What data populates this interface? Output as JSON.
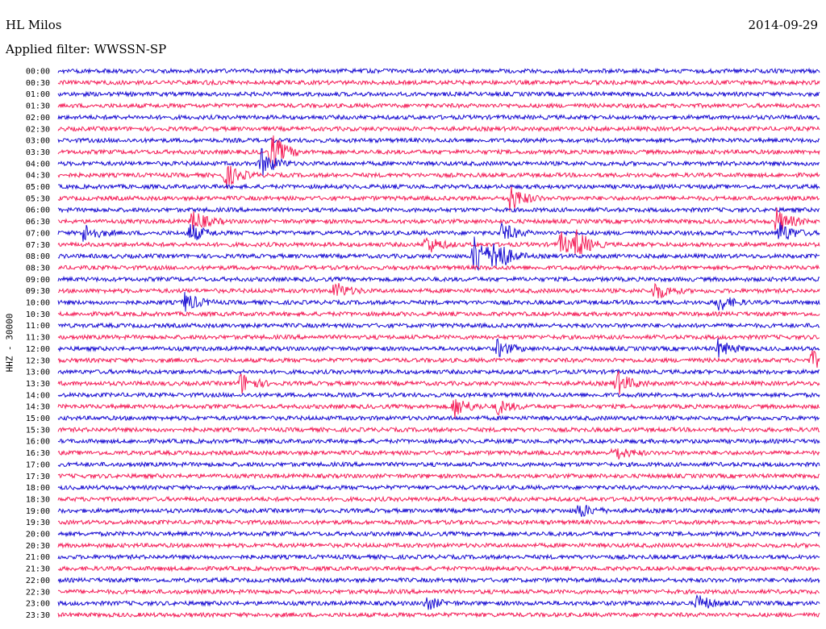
{
  "header": {
    "station": "HL Milos",
    "filter_label": "Applied filter: WWSSN-SP",
    "date": "2014-09-29"
  },
  "colors": {
    "blue": "#1a0ed2",
    "red": "#f4205a",
    "background": "#ffffff"
  },
  "chart_data": {
    "type": "line",
    "title": "HL Milos",
    "subtitle": "Applied filter: WWSSN-SP",
    "date": "2014-09-29",
    "ylabel": "HHZ - 30000",
    "xlabel": "",
    "grid": false,
    "legend": "none",
    "trace_colors_alternate": [
      "blue",
      "red"
    ],
    "row_labels": [
      "00:00",
      "00:30",
      "01:00",
      "01:30",
      "02:00",
      "02:30",
      "03:00",
      "03:30",
      "04:00",
      "04:30",
      "05:00",
      "05:30",
      "06:00",
      "06:30",
      "07:00",
      "07:30",
      "08:00",
      "08:30",
      "09:00",
      "09:30",
      "10:00",
      "10:30",
      "11:00",
      "11:30",
      "12:00",
      "12:30",
      "13:00",
      "13:30",
      "14:00",
      "14:30",
      "15:00",
      "15:30",
      "16:00",
      "16:30",
      "17:00",
      "17:30",
      "18:00",
      "18:30",
      "19:00",
      "19:30",
      "20:00",
      "20:30",
      "21:00",
      "21:30",
      "22:00",
      "22:30",
      "23:00",
      "23:30"
    ],
    "minutes_per_row": 30,
    "events": [
      {
        "row": "03:30",
        "minute": 8.4,
        "amplitude": 2.0
      },
      {
        "row": "04:00",
        "minute": 8.0,
        "amplitude": 1.5
      },
      {
        "row": "04:30",
        "minute": 6.6,
        "amplitude": 1.3
      },
      {
        "row": "05:30",
        "minute": 17.8,
        "amplitude": 1.4
      },
      {
        "row": "06:30",
        "minute": 5.3,
        "amplitude": 1.2
      },
      {
        "row": "06:30",
        "minute": 28.3,
        "amplitude": 1.4
      },
      {
        "row": "07:00",
        "minute": 1.0,
        "amplitude": 1.0
      },
      {
        "row": "07:00",
        "minute": 5.2,
        "amplitude": 1.0
      },
      {
        "row": "07:00",
        "minute": 17.5,
        "amplitude": 1.0
      },
      {
        "row": "07:00",
        "minute": 28.4,
        "amplitude": 1.2
      },
      {
        "row": "07:30",
        "minute": 14.5,
        "amplitude": 1.0
      },
      {
        "row": "07:30",
        "minute": 19.8,
        "amplitude": 1.2
      },
      {
        "row": "07:30",
        "minute": 20.4,
        "amplitude": 1.3
      },
      {
        "row": "08:00",
        "minute": 16.4,
        "amplitude": 2.5
      },
      {
        "row": "08:00",
        "minute": 17.2,
        "amplitude": 2.0
      },
      {
        "row": "09:30",
        "minute": 10.9,
        "amplitude": 0.9
      },
      {
        "row": "09:30",
        "minute": 23.5,
        "amplitude": 1.0
      },
      {
        "row": "10:00",
        "minute": 5.0,
        "amplitude": 1.0
      },
      {
        "row": "10:00",
        "minute": 26.0,
        "amplitude": 0.9
      },
      {
        "row": "12:00",
        "minute": 17.3,
        "amplitude": 0.9
      },
      {
        "row": "12:00",
        "minute": 26.0,
        "amplitude": 0.9
      },
      {
        "row": "12:30",
        "minute": 29.7,
        "amplitude": 0.9
      },
      {
        "row": "13:30",
        "minute": 7.2,
        "amplitude": 1.1
      },
      {
        "row": "13:30",
        "minute": 22.0,
        "amplitude": 1.3
      },
      {
        "row": "14:30",
        "minute": 15.6,
        "amplitude": 1.2
      },
      {
        "row": "14:30",
        "minute": 17.3,
        "amplitude": 0.8
      },
      {
        "row": "16:30",
        "minute": 21.9,
        "amplitude": 0.8
      },
      {
        "row": "19:00",
        "minute": 20.5,
        "amplitude": 0.8
      },
      {
        "row": "23:00",
        "minute": 14.5,
        "amplitude": 0.7
      },
      {
        "row": "23:00",
        "minute": 25.2,
        "amplitude": 0.9
      }
    ]
  }
}
